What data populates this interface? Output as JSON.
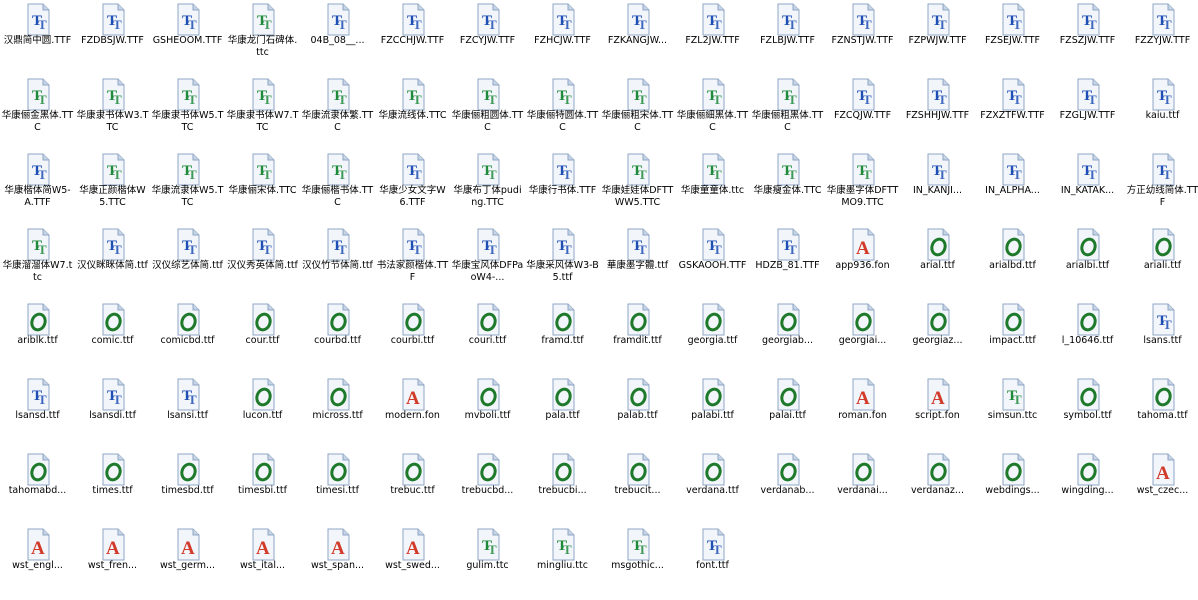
{
  "window": {
    "view": "Fonts folder - large icons"
  },
  "colors": {
    "tt_blue": "#1f4fb4",
    "tt_green": "#1f8a3a",
    "opentype_green": "#1e7a2a",
    "raster_red": "#d23a2a",
    "paper": "#f2f6fb",
    "fold": "#c7d4e6"
  },
  "files": [
    {
      "name": "汉鼎简中圆.TTF",
      "type": "tt-blue"
    },
    {
      "name": "FZDBSJW.TTF",
      "type": "tt-blue"
    },
    {
      "name": "GSHEOOM.TTF",
      "type": "tt-blue"
    },
    {
      "name": "华康龙门石碑体.ttc",
      "type": "tt-green"
    },
    {
      "name": "04B_08__...",
      "type": "tt-blue"
    },
    {
      "name": "FZCCHJW.TTF",
      "type": "tt-blue"
    },
    {
      "name": "FZCYJW.TTF",
      "type": "tt-blue"
    },
    {
      "name": "FZHCJW.TTF",
      "type": "tt-blue"
    },
    {
      "name": "FZKANGJW...",
      "type": "tt-blue"
    },
    {
      "name": "FZL2JW.TTF",
      "type": "tt-blue"
    },
    {
      "name": "FZLBJW.TTF",
      "type": "tt-blue"
    },
    {
      "name": "FZNSTJW.TTF",
      "type": "tt-blue"
    },
    {
      "name": "FZPWJW.TTF",
      "type": "tt-blue"
    },
    {
      "name": "FZSEJW.TTF",
      "type": "tt-blue"
    },
    {
      "name": "FZSZJW.TTF",
      "type": "tt-blue"
    },
    {
      "name": "FZZYJW.TTF",
      "type": "tt-blue"
    },
    {
      "name": "华康俪金黑体.TTC",
      "type": "tt-green"
    },
    {
      "name": "华康隶书体W3.TTC",
      "type": "tt-green"
    },
    {
      "name": "华康隶书体W5.TTC",
      "type": "tt-green"
    },
    {
      "name": "华康隶书体W7.TTC",
      "type": "tt-green"
    },
    {
      "name": "华康流隶体繁.TTC",
      "type": "tt-green"
    },
    {
      "name": "华康流线体.TTC",
      "type": "tt-green"
    },
    {
      "name": "华康俪粗圆体.TTC",
      "type": "tt-green"
    },
    {
      "name": "华康俪特圆体.TTC",
      "type": "tt-green"
    },
    {
      "name": "华康俪粗宋体.TTC",
      "type": "tt-green"
    },
    {
      "name": "华康俪細黑体.TTC",
      "type": "tt-green"
    },
    {
      "name": "华康俪粗黑体.TTC",
      "type": "tt-green"
    },
    {
      "name": "FZCQJW.TTF",
      "type": "tt-blue"
    },
    {
      "name": "FZSHHJW.TTF",
      "type": "tt-blue"
    },
    {
      "name": "FZXZTFW.TTF",
      "type": "tt-blue"
    },
    {
      "name": "FZGLJW.TTF",
      "type": "tt-blue"
    },
    {
      "name": "kaiu.ttf",
      "type": "tt-blue"
    },
    {
      "name": "华康楷体简W5-A.TTF",
      "type": "tt-blue"
    },
    {
      "name": "华康正颜楷体W5.TTC",
      "type": "tt-green"
    },
    {
      "name": "华康流隶体W5.TTC",
      "type": "tt-green"
    },
    {
      "name": "华康俪宋体.TTC",
      "type": "tt-green"
    },
    {
      "name": "华康俪楷书体.TTC",
      "type": "tt-green"
    },
    {
      "name": "华康少女文字W6.TTF",
      "type": "tt-blue"
    },
    {
      "name": "华康布丁体puding.TTC",
      "type": "tt-green"
    },
    {
      "name": "华康行书体.TTF",
      "type": "tt-blue"
    },
    {
      "name": "华康娃娃体DFTTWW5.TTC",
      "type": "tt-green"
    },
    {
      "name": "华康童童体.ttc",
      "type": "tt-green"
    },
    {
      "name": "华康瘦金体.TTC",
      "type": "tt-green"
    },
    {
      "name": "华康墨字体DFTTMO9.TTC",
      "type": "tt-green"
    },
    {
      "name": "IN_KANJI...",
      "type": "tt-blue"
    },
    {
      "name": "IN_ALPHA...",
      "type": "tt-blue"
    },
    {
      "name": "IN_KATAK...",
      "type": "tt-blue"
    },
    {
      "name": "方正幼线简体.TTF",
      "type": "tt-blue"
    },
    {
      "name": "华康溜溜体W7.ttc",
      "type": "tt-green"
    },
    {
      "name": "汉仪眯眯体简.ttf",
      "type": "tt-blue"
    },
    {
      "name": "汉仪综艺体简.ttf",
      "type": "tt-blue"
    },
    {
      "name": "汉仪秀英体简.ttf",
      "type": "tt-blue"
    },
    {
      "name": "汉仪竹节体简.ttf",
      "type": "tt-blue"
    },
    {
      "name": "书法家颜楷体.TTF",
      "type": "tt-blue"
    },
    {
      "name": "华康宝风体DFPaoW4-...",
      "type": "tt-blue"
    },
    {
      "name": "华康采风体W3-B5.ttf",
      "type": "tt-blue"
    },
    {
      "name": "華康墨字體.ttf",
      "type": "tt-blue"
    },
    {
      "name": "GSKAOOH.TTF",
      "type": "tt-blue"
    },
    {
      "name": "HDZB_81.TTF",
      "type": "tt-blue"
    },
    {
      "name": "app936.fon",
      "type": "raster"
    },
    {
      "name": "arial.ttf",
      "type": "opentype"
    },
    {
      "name": "arialbd.ttf",
      "type": "opentype"
    },
    {
      "name": "arialbi.ttf",
      "type": "opentype"
    },
    {
      "name": "ariali.ttf",
      "type": "opentype"
    },
    {
      "name": "ariblk.ttf",
      "type": "opentype"
    },
    {
      "name": "comic.ttf",
      "type": "opentype"
    },
    {
      "name": "comicbd.ttf",
      "type": "opentype"
    },
    {
      "name": "cour.ttf",
      "type": "opentype"
    },
    {
      "name": "courbd.ttf",
      "type": "opentype"
    },
    {
      "name": "courbi.ttf",
      "type": "opentype"
    },
    {
      "name": "couri.ttf",
      "type": "opentype"
    },
    {
      "name": "framd.ttf",
      "type": "opentype"
    },
    {
      "name": "framdit.ttf",
      "type": "opentype"
    },
    {
      "name": "georgia.ttf",
      "type": "opentype"
    },
    {
      "name": "georgiab...",
      "type": "opentype"
    },
    {
      "name": "georgiai...",
      "type": "opentype"
    },
    {
      "name": "georgiaz...",
      "type": "opentype"
    },
    {
      "name": "impact.ttf",
      "type": "opentype"
    },
    {
      "name": "l_10646.ttf",
      "type": "opentype"
    },
    {
      "name": "lsans.ttf",
      "type": "tt-blue"
    },
    {
      "name": "lsansd.ttf",
      "type": "tt-blue"
    },
    {
      "name": "lsansdi.ttf",
      "type": "tt-blue"
    },
    {
      "name": "lsansi.ttf",
      "type": "tt-blue"
    },
    {
      "name": "lucon.ttf",
      "type": "opentype"
    },
    {
      "name": "micross.ttf",
      "type": "opentype"
    },
    {
      "name": "modern.fon",
      "type": "raster"
    },
    {
      "name": "mvboli.ttf",
      "type": "opentype"
    },
    {
      "name": "pala.ttf",
      "type": "opentype"
    },
    {
      "name": "palab.ttf",
      "type": "opentype"
    },
    {
      "name": "palabi.ttf",
      "type": "opentype"
    },
    {
      "name": "palai.ttf",
      "type": "opentype"
    },
    {
      "name": "roman.fon",
      "type": "raster"
    },
    {
      "name": "script.fon",
      "type": "raster"
    },
    {
      "name": "simsun.ttc",
      "type": "tt-green"
    },
    {
      "name": "symbol.ttf",
      "type": "opentype"
    },
    {
      "name": "tahoma.ttf",
      "type": "opentype"
    },
    {
      "name": "tahomabd...",
      "type": "opentype"
    },
    {
      "name": "times.ttf",
      "type": "opentype"
    },
    {
      "name": "timesbd.ttf",
      "type": "opentype"
    },
    {
      "name": "timesbi.ttf",
      "type": "opentype"
    },
    {
      "name": "timesi.ttf",
      "type": "opentype"
    },
    {
      "name": "trebuc.ttf",
      "type": "opentype"
    },
    {
      "name": "trebucbd...",
      "type": "opentype"
    },
    {
      "name": "trebucbi...",
      "type": "opentype"
    },
    {
      "name": "trebucit...",
      "type": "opentype"
    },
    {
      "name": "verdana.ttf",
      "type": "opentype"
    },
    {
      "name": "verdanab...",
      "type": "opentype"
    },
    {
      "name": "verdanai...",
      "type": "opentype"
    },
    {
      "name": "verdanaz...",
      "type": "opentype"
    },
    {
      "name": "webdings...",
      "type": "opentype"
    },
    {
      "name": "wingding...",
      "type": "opentype"
    },
    {
      "name": "wst_czec...",
      "type": "raster"
    },
    {
      "name": "wst_engl...",
      "type": "raster"
    },
    {
      "name": "wst_fren...",
      "type": "raster"
    },
    {
      "name": "wst_germ...",
      "type": "raster"
    },
    {
      "name": "wst_ital...",
      "type": "raster"
    },
    {
      "name": "wst_span...",
      "type": "raster"
    },
    {
      "name": "wst_swed...",
      "type": "raster"
    },
    {
      "name": "gulim.ttc",
      "type": "tt-green"
    },
    {
      "name": "mingliu.ttc",
      "type": "tt-green"
    },
    {
      "name": "msgothic...",
      "type": "tt-green"
    },
    {
      "name": "font.ttf",
      "type": "tt-blue"
    }
  ]
}
